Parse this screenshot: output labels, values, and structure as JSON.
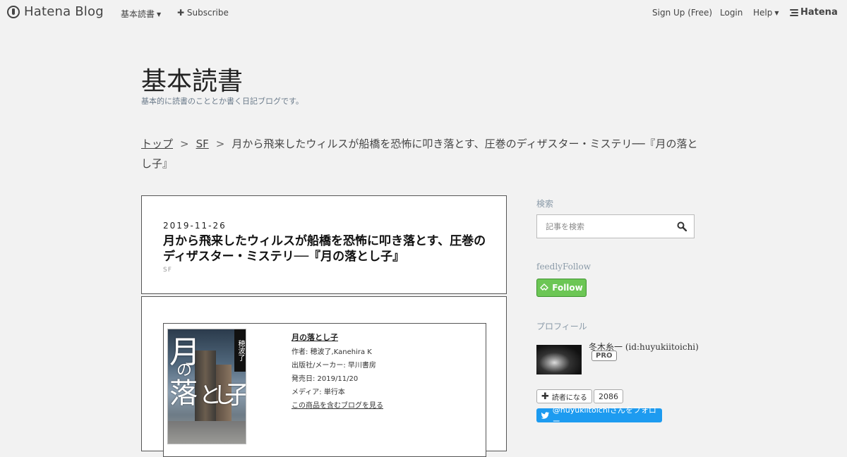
{
  "topbar": {
    "brand": "Hatena Blog",
    "menu_blog": "基本読書",
    "subscribe": "Subscribe",
    "signup": "Sign Up (Free)",
    "login": "Login",
    "help": "Help",
    "hatena": "Hatena"
  },
  "blog": {
    "title": "基本読書",
    "description": "基本的に読書のこととか書く日記ブログです。"
  },
  "breadcrumb": {
    "top": "トップ",
    "category": "SF",
    "separator": ">",
    "current": "月から飛来したウィルスが船橋を恐怖に叩き落とす、圧巻のディザスター・ミステリ──『月の落とし子』"
  },
  "entry": {
    "date": "2019-11-26",
    "title": "月から飛来したウィルスが船橋を恐怖に叩き落とす、圧巻のディザスター・ミステリ──『月の落とし子』",
    "category": "SF"
  },
  "product": {
    "title": "月の落とし子",
    "author": "作者: 穂波了,Kanehira K",
    "publisher": "出版社/メーカー: 早川書房",
    "release": "発売日: 2019/11/20",
    "media": "メディア: 単行本",
    "blog_link": "この商品を含むブログを見る",
    "cover_title": "月の落とし子",
    "cover_author": "穂波了"
  },
  "sidebar": {
    "search_heading": "検索",
    "search_placeholder": "記事を検索",
    "feedly_label": "feedlyFollow",
    "feedly_button": "Follow",
    "profile_heading": "プロフィール",
    "profile_name": "冬木糸一 (id:huyukiitoichi)",
    "pro_badge": "PRO",
    "reader_button": "読者になる",
    "reader_count": "2086",
    "twitter_follow": "@huyukiitoichiさんをフォロー"
  },
  "colors": {
    "background": "#f2f2f2",
    "feedly_green": "#6cc655",
    "twitter_blue": "#1d9bf0",
    "muted_heading": "#8a9aa8"
  }
}
